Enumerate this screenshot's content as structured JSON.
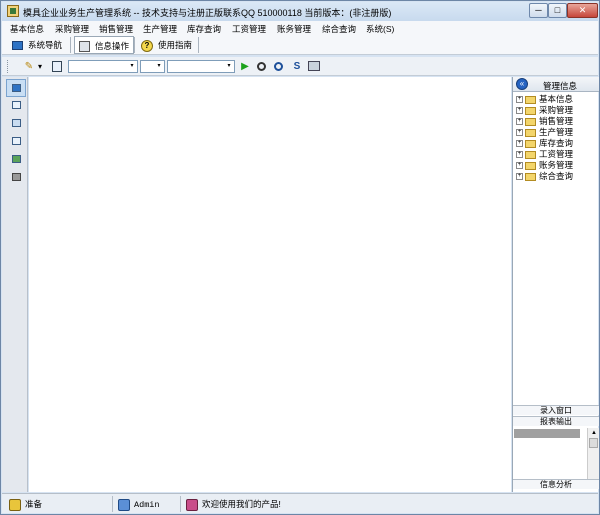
{
  "window": {
    "title": "模具企业业务生产管理系统 -- 技术支持与注册正版联系QQ 510000118    当前版本：(非注册版)",
    "min_label": "─",
    "max_label": "□",
    "close_label": "✕"
  },
  "menu": [
    "基本信息",
    "采购管理",
    "销售管理",
    "生产管理",
    "库存查询",
    "工资管理",
    "账务管理",
    "综合查询",
    "系统(S)"
  ],
  "nav": {
    "system_nav": "系统导航",
    "info_ops": "信息操作",
    "user_guide": "使用指南",
    "help_glyph": "?"
  },
  "toolbar": {
    "pencil_glyph": "✎",
    "dropdown_glyph": "▾",
    "play_glyph": "▶",
    "combo1_value": "",
    "combo2_value": "",
    "combo3_value": ""
  },
  "right_panel": {
    "header": "管理信息",
    "back_glyph": "«",
    "tree": [
      "基本信息",
      "采购管理",
      "销售管理",
      "生产管理",
      "库存查询",
      "工资管理",
      "账务管理",
      "综合查询"
    ],
    "expand_glyph": "+",
    "tab_entry": "录入窗口",
    "tab_report": "报表输出",
    "tab_analysis": "信息分析",
    "scroll_up": "▲",
    "scroll_down": "▼"
  },
  "status": {
    "ready": "准备",
    "user": "Admin",
    "welcome": "欢迎使用我们的产品!"
  },
  "colors": {
    "window_frame": "#d6e3f2",
    "accent_blue": "#2563c2",
    "folder_yellow": "#f3d56b",
    "play_green": "#1ca21c"
  }
}
